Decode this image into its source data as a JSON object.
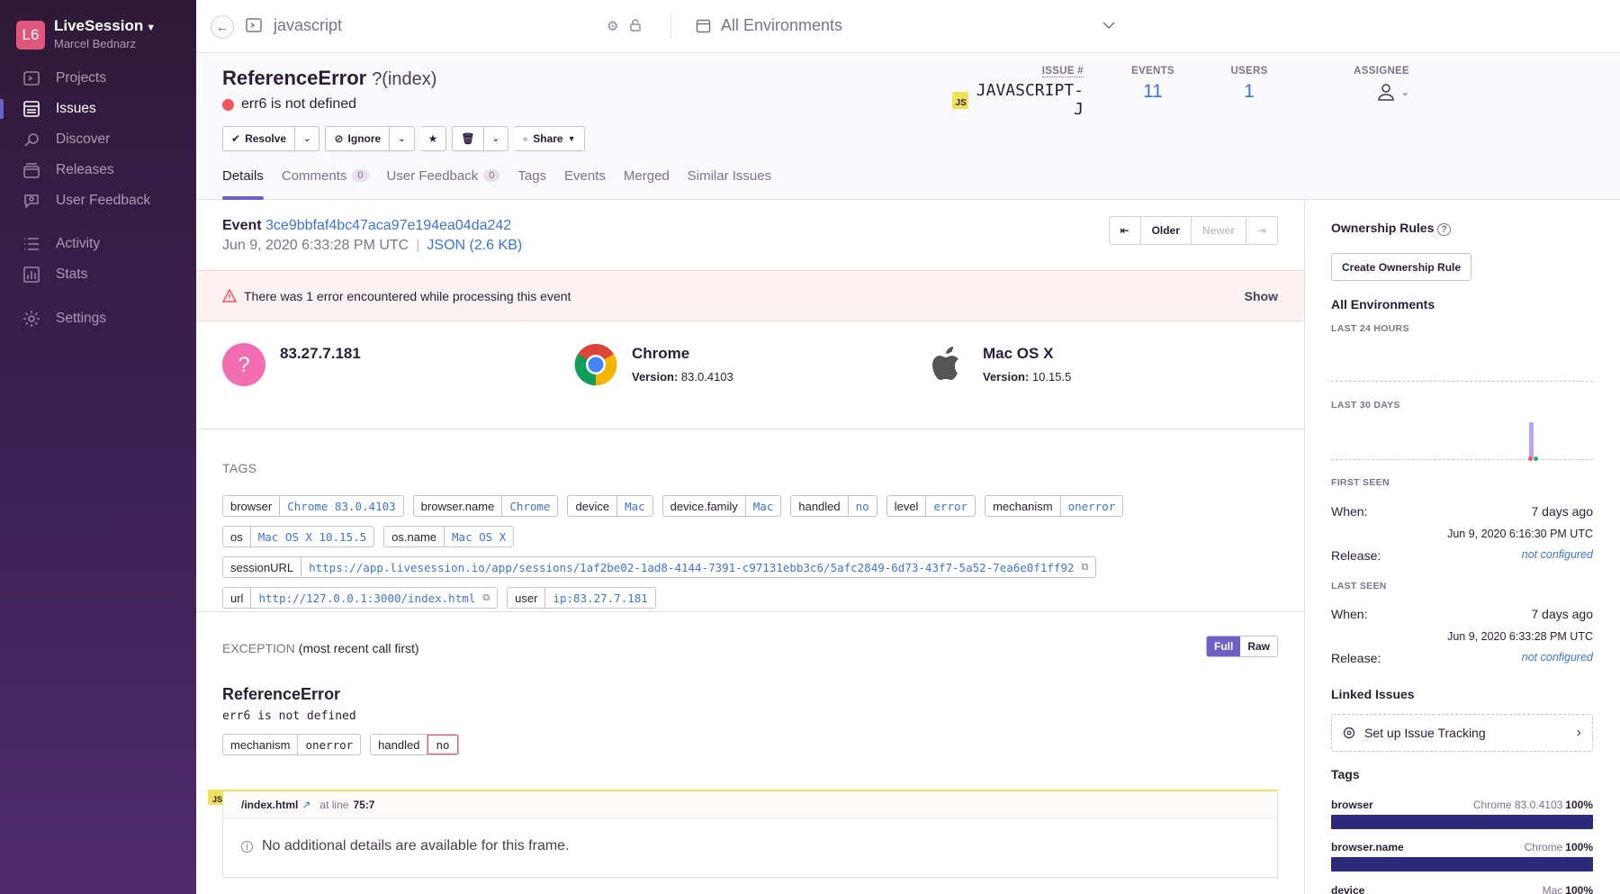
{
  "org": {
    "initials": "L6",
    "name": "LiveSession",
    "user": "Marcel Bednarz"
  },
  "nav": {
    "projects": "Projects",
    "issues": "Issues",
    "discover": "Discover",
    "releases": "Releases",
    "user_feedback": "User Feedback",
    "activity": "Activity",
    "stats": "Stats",
    "settings": "Settings"
  },
  "topbar": {
    "project": "javascript",
    "environment": "All Environments"
  },
  "issue": {
    "title": "ReferenceError",
    "location": "?(index)",
    "message": "err6 is not defined",
    "issue_label": "ISSUE #",
    "short_id": "JAVASCRIPT-J",
    "events_label": "EVENTS",
    "events": "11",
    "users_label": "USERS",
    "users": "1",
    "assignee_label": "ASSIGNEE"
  },
  "actions": {
    "resolve": "Resolve",
    "ignore": "Ignore",
    "share": "Share"
  },
  "tabs": [
    {
      "label": "Details"
    },
    {
      "label": "Comments",
      "count": "0"
    },
    {
      "label": "User Feedback",
      "count": "0"
    },
    {
      "label": "Tags"
    },
    {
      "label": "Events"
    },
    {
      "label": "Merged"
    },
    {
      "label": "Similar Issues"
    }
  ],
  "event": {
    "label": "Event",
    "id": "3ce9bbfaf4bc47aca97e194ea04da242",
    "date": "Jun 9, 2020 6:33:28 PM UTC",
    "json": "JSON (2.6 KB)",
    "older": "Older",
    "newer": "Newer"
  },
  "error_banner": {
    "text": "There was 1 error encountered while processing this event",
    "show": "Show"
  },
  "contexts": {
    "user": {
      "icon": "?",
      "title": "83.27.7.181"
    },
    "browser": {
      "title": "Chrome",
      "version_label": "Version:",
      "version": "83.0.4103"
    },
    "os": {
      "title": "Mac OS X",
      "version_label": "Version:",
      "version": "10.15.5"
    }
  },
  "tags_section": {
    "label": "TAGS",
    "rows": [
      [
        {
          "key": "browser",
          "value": "Chrome 83.0.4103"
        },
        {
          "key": "browser.name",
          "value": "Chrome"
        },
        {
          "key": "device",
          "value": "Mac"
        },
        {
          "key": "device.family",
          "value": "Mac"
        },
        {
          "key": "handled",
          "value": "no"
        },
        {
          "key": "level",
          "value": "error"
        },
        {
          "key": "mechanism",
          "value": "onerror"
        }
      ],
      [
        {
          "key": "os",
          "value": "Mac OS X 10.15.5"
        },
        {
          "key": "os.name",
          "value": "Mac OS X"
        }
      ],
      [
        {
          "key": "sessionURL",
          "value": "https://app.livesession.io/app/sessions/1af2be02-1ad8-4144-7391-c97131ebb3c6/5afc2849-6d73-43f7-5a52-7ea6e0f1ff92",
          "external": true
        }
      ],
      [
        {
          "key": "url",
          "value": "http://127.0.0.1:3000/index.html",
          "external": true
        },
        {
          "key": "user",
          "value": "ip:83.27.7.181"
        }
      ]
    ]
  },
  "exception": {
    "label": "EXCEPTION",
    "desc": "(most recent call first)",
    "full": "Full",
    "raw": "Raw",
    "type": "ReferenceError",
    "value": "err6 is not defined",
    "mechanism_key": "mechanism",
    "mechanism_val": "onerror",
    "handled_key": "handled",
    "handled_val": "no",
    "frame_badge": "JS",
    "frame_file": "/index.html",
    "frame_at": "at line",
    "frame_line": "75:7",
    "frame_body": "No additional details are available for this frame."
  },
  "sidebar_right": {
    "ownership_title": "Ownership Rules",
    "ownership_btn": "Create Ownership Rule",
    "env_title": "All Environments",
    "last24": "LAST 24 HOURS",
    "last30": "LAST 30 DAYS",
    "first_seen": "FIRST SEEN",
    "first_when_label": "When:",
    "first_when": "7 days ago",
    "first_date": "Jun 9, 2020 6:16:30 PM UTC",
    "first_release_label": "Release:",
    "first_release": "not configured",
    "last_seen": "LAST SEEN",
    "last_when_label": "When:",
    "last_when": "7 days ago",
    "last_date": "Jun 9, 2020 6:33:28 PM UTC",
    "last_release_label": "Release:",
    "last_release": "not configured",
    "linked_title": "Linked Issues",
    "linked_btn": "Set up Issue Tracking",
    "tags_title": "Tags",
    "tag_meters": [
      {
        "key": "browser",
        "value": "Chrome 83.0.4103",
        "pct": "100%"
      },
      {
        "key": "browser.name",
        "value": "Chrome",
        "pct": "100%"
      },
      {
        "key": "device",
        "value": "Mac",
        "pct": "100%"
      }
    ]
  }
}
